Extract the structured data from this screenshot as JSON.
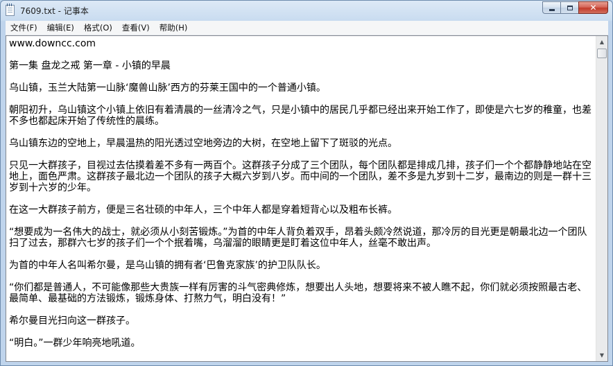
{
  "window": {
    "title": "7609.txt - 记事本",
    "close_glyph": "✕"
  },
  "menu": [
    {
      "label": "文件(F)"
    },
    {
      "label": "编辑(E)"
    },
    {
      "label": "格式(O)"
    },
    {
      "label": "查看(V)"
    },
    {
      "label": "帮助(H)"
    }
  ],
  "document": {
    "paragraphs": [
      "www.downcc.com",
      "第一集 盘龙之戒 第一章 - 小镇的早晨",
      "乌山镇，玉兰大陆第一山脉‘魔兽山脉’西方的芬莱王国中的一个普通小镇。",
      "朝阳初升，乌山镇这个小镇上依旧有着清晨的一丝清冷之气，只是小镇中的居民几乎都已经出来开始工作了，即使是六七岁的稚童，也差不多也都起床开始了传统性的晨练。",
      "乌山镇东边的空地上，早晨温热的阳光透过空地旁边的大树，在空地上留下了斑驳的光点。",
      "只见一大群孩子，目视过去估摸着差不多有一两百个。这群孩子分成了三个团队，每个团队都是排成几排，孩子们一个个都静静地站在空地上，面色严肃。这群孩子最北边一个团队的孩子大概六岁到八岁。而中间的一个团队，差不多是九岁到十二岁，最南边的则是一群十三岁到十六岁的少年。",
      "在这一大群孩子前方，便是三名壮硕的中年人，三个中年人都是穿着短背心以及粗布长裤。",
      "“想要成为一名伟大的战士，就必须从小刻苦锻炼。”为首的中年人背负着双手，昂着头颇冷然说道，那冷厉的目光更是朝最北边一个团队扫了过去，那群六七岁的孩子们一个个抿着嘴，乌溜溜的眼睛更是盯着这位中年人，丝毫不敢出声。",
      "为首的中年人名叫希尔曼，是乌山镇的拥有者‘巴鲁克家族’的护卫队队长。",
      "“你们都是普通人，不可能像那些大贵族一样有厉害的斗气密典修炼，想要出人头地，想要将来不被人瞧不起，你们就必须按照最古老、最简单、最基础的方法锻炼，锻炼身体、打熬力气，明白没有！”",
      "希尔曼目光扫向这一群孩子。",
      "“明白。”一群少年响亮地吼道。"
    ]
  },
  "scrollbar": {
    "up_glyph": "▲",
    "down_glyph": "▼"
  }
}
